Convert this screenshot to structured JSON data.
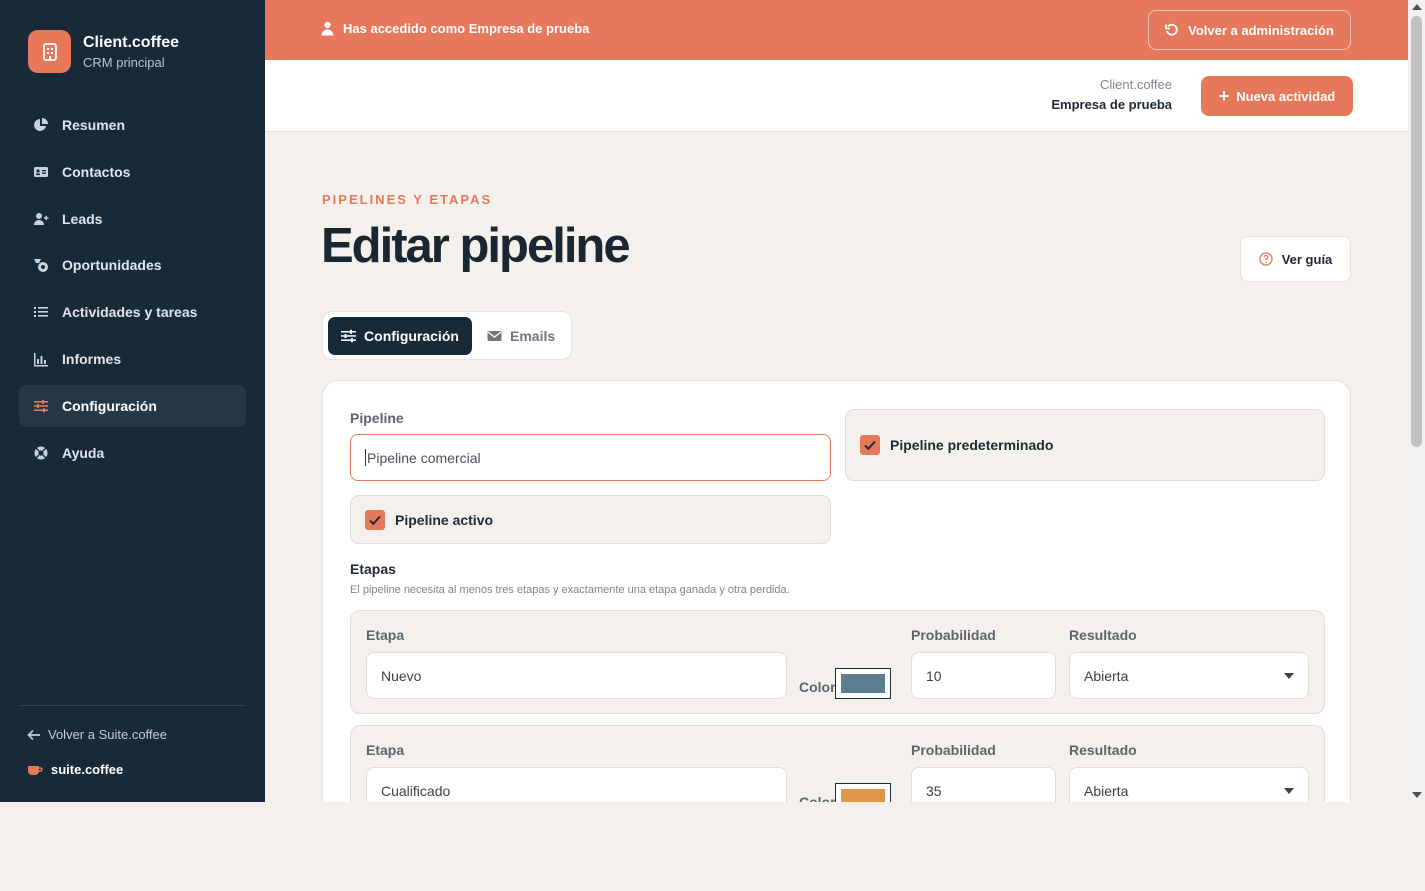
{
  "colors": {
    "accent": "#e6785b",
    "sidebar": "#182a38",
    "background": "#f4f1ec"
  },
  "brand": {
    "name": "Client.coffee",
    "subtitle": "CRM principal",
    "icon": "building-icon"
  },
  "nav": {
    "items": [
      {
        "label": "Resumen",
        "icon": "pie-chart-icon"
      },
      {
        "label": "Contactos",
        "icon": "address-card-icon"
      },
      {
        "label": "Leads",
        "icon": "user-plus-icon"
      },
      {
        "label": "Oportunidades",
        "icon": "coins-icon"
      },
      {
        "label": "Actividades y tareas",
        "icon": "list-icon"
      },
      {
        "label": "Informes",
        "icon": "bar-chart-icon"
      },
      {
        "label": "Configuración",
        "icon": "sliders-icon",
        "active": true
      },
      {
        "label": "Ayuda",
        "icon": "life-ring-icon"
      }
    ],
    "back_label": "Volver a Suite.coffee",
    "suite_label": "suite.coffee"
  },
  "banner": {
    "text": "Has accedido como Empresa de prueba",
    "button": "Volver a administración"
  },
  "header": {
    "company_line1": "Client.coffee",
    "company_line2": "Empresa de prueba",
    "new_activity": "Nueva actividad"
  },
  "page": {
    "eyebrow": "PIPELINES Y ETAPAS",
    "title": "Editar pipeline",
    "guide_button": "Ver guía"
  },
  "tabs": [
    {
      "label": "Configuración",
      "active": true
    },
    {
      "label": "Emails",
      "active": false
    }
  ],
  "form": {
    "pipeline_label": "Pipeline",
    "pipeline_value": "Pipeline comercial",
    "default_label": "Pipeline predeterminado",
    "default_checked": true,
    "active_label": "Pipeline activo",
    "active_checked": true,
    "stages_title": "Etapas",
    "stages_desc": "El pipeline necesita al menos tres etapas y exactamente una etapa ganada y otra perdida.",
    "col_stage": "Etapa",
    "col_color": "Color",
    "col_probability": "Probabilidad",
    "col_result": "Resultado",
    "stages": [
      {
        "name": "Nuevo",
        "color": "#5e7d8e",
        "probability": "10",
        "result": "Abierta"
      },
      {
        "name": "Cualificado",
        "color": "#e0954a",
        "probability": "35",
        "result": "Abierta"
      }
    ]
  }
}
